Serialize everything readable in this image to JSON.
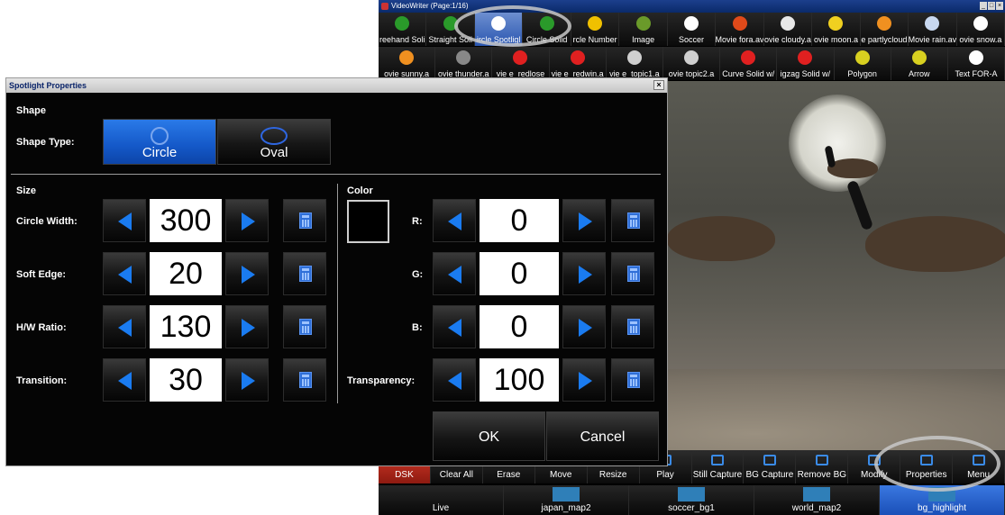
{
  "app": {
    "title": "VideoWriter (Page:1/16)",
    "window_controls": [
      "_",
      "□",
      "×"
    ],
    "palette_row_1": [
      {
        "label": "reehand Soli",
        "icon": "freehand-icon",
        "color": "#2a9a2a"
      },
      {
        "label": "Straight Soli",
        "icon": "line-icon",
        "color": "#2a9a2a"
      },
      {
        "label": "ircle Spotligl",
        "icon": "spotlight-icon",
        "color": "#ffffff",
        "selected": true
      },
      {
        "label": "Circle Solid",
        "icon": "circle-icon",
        "color": "#2a9a2a"
      },
      {
        "label": "rcle Number",
        "icon": "number-icon",
        "color": "#f0c000"
      },
      {
        "label": "Image",
        "icon": "image-icon",
        "color": "#6a9a2a"
      },
      {
        "label": "Soccer",
        "icon": "soccer-icon",
        "color": "#ffffff"
      },
      {
        "label": "Movie fora.av",
        "icon": "movie-icon",
        "color": "#e04a1a"
      },
      {
        "label": "ovie cloudy.a",
        "icon": "cloud-icon",
        "color": "#e8e8e8"
      },
      {
        "label": "ovie moon.a",
        "icon": "moon-icon",
        "color": "#f0d020"
      },
      {
        "label": "e partlycloud",
        "icon": "partlycloud-icon",
        "color": "#f09020"
      },
      {
        "label": "Movie rain.av",
        "icon": "rain-icon",
        "color": "#c8d8f0"
      },
      {
        "label": "ovie snow.a",
        "icon": "snow-icon",
        "color": "#ffffff"
      }
    ],
    "palette_row_2": [
      {
        "label": "ovie sunny.a",
        "icon": "sun-icon",
        "color": "#f09020"
      },
      {
        "label": "ovie thunder.a",
        "icon": "thunder-icon",
        "color": "#888888"
      },
      {
        "label": "vie e_redlose",
        "icon": "red-box-icon",
        "color": "#e02020"
      },
      {
        "label": "vie e_redwin.a",
        "icon": "red-box-icon",
        "color": "#e02020"
      },
      {
        "label": "vie e_topic1.a",
        "icon": "topic-icon",
        "color": "#cfcfcf"
      },
      {
        "label": "ovie topic2.a",
        "icon": "topic-icon",
        "color": "#cfcfcf"
      },
      {
        "label": "Curve Solid w/",
        "icon": "curve-icon",
        "color": "#e02020"
      },
      {
        "label": "igzag Solid w/",
        "icon": "zigzag-icon",
        "color": "#e02020"
      },
      {
        "label": "Polygon",
        "icon": "polygon-icon",
        "color": "#d8d020"
      },
      {
        "label": "Arrow",
        "icon": "arrow-icon",
        "color": "#d8d020"
      },
      {
        "label": "Text FOR-A",
        "icon": "text-icon",
        "color": "#ffffff"
      }
    ],
    "toolbar": [
      {
        "label": "DSK",
        "icon": "dsk-icon"
      },
      {
        "label": "Clear All",
        "icon": "clear-all-icon"
      },
      {
        "label": "Erase",
        "icon": "erase-icon"
      },
      {
        "label": "Move",
        "icon": "move-icon"
      },
      {
        "label": "Resize",
        "icon": "resize-icon"
      },
      {
        "label": "Play",
        "icon": "play-icon"
      },
      {
        "label": "Still Capture",
        "icon": "camera-icon"
      },
      {
        "label": "BG Capture",
        "icon": "bg-capture-icon"
      },
      {
        "label": "Remove BG",
        "icon": "remove-bg-icon"
      },
      {
        "label": "Modify",
        "icon": "modify-icon"
      },
      {
        "label": "Properties",
        "icon": "gear-icon"
      },
      {
        "label": "Menu",
        "icon": "menu-icon"
      }
    ],
    "backgrounds": [
      {
        "label": "Live"
      },
      {
        "label": "japan_map2"
      },
      {
        "label": "soccer_bg1"
      },
      {
        "label": "world_map2"
      },
      {
        "label": "bg_highlight",
        "selected": true
      }
    ]
  },
  "dialog": {
    "title": "Spotlight Properties",
    "close_glyph": "×",
    "shape_section": "Shape",
    "shape_type_label": "Shape Type:",
    "shape_options": {
      "circle": "Circle",
      "oval": "Oval"
    },
    "selected_shape": "Circle",
    "size_section": "Size",
    "color_section": "Color",
    "swatch_color": "#000000",
    "size_fields": {
      "circle_width": {
        "label": "Circle Width:",
        "value": "300"
      },
      "soft_edge": {
        "label": "Soft Edge:",
        "value": "20"
      },
      "hw_ratio": {
        "label": "H/W Ratio:",
        "value": "130"
      },
      "transition": {
        "label": "Transition:",
        "value": "30"
      }
    },
    "color_fields": {
      "r": {
        "label": "R:",
        "value": "0"
      },
      "g": {
        "label": "G:",
        "value": "0"
      },
      "b": {
        "label": "B:",
        "value": "0"
      },
      "transparency": {
        "label": "Transparency:",
        "value": "100"
      }
    },
    "ok_label": "OK",
    "cancel_label": "Cancel"
  }
}
